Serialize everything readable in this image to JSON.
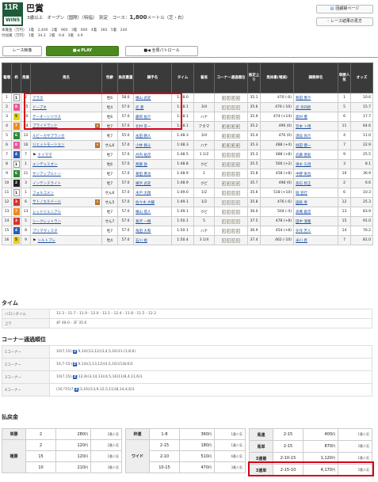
{
  "header": {
    "race_no": "11R",
    "badge": "WIN5",
    "title": "巴賞",
    "conditions_prefix": "3歳以上　オープン（国際）（特指）　別定　コース：",
    "distance": "1,800",
    "conditions_suffix": "メートル（芝・右）",
    "prize_line1": "本賞金（万円）　1着　2,400　2着　960　3着　600　4着　360　5着　240",
    "prize_line2": "付加賞（万円）　1着　34.3　2着　9.8　3着　4.9",
    "btn_tally": "回顧録ページ",
    "btn_result_list": "レース結果の見方"
  },
  "tabs": {
    "race_video": "レース映像",
    "play": "PLAY",
    "patrol": "全周パトロール"
  },
  "table": {
    "headers": [
      "着順",
      "枠",
      "馬番",
      "馬名",
      "性齢",
      "負担重量",
      "騎手名",
      "タイム",
      "着差",
      "コーナー通過順位",
      "推定上り",
      "馬体重(増減)",
      "調教師名",
      "単勝人気",
      "オッズ"
    ],
    "rows": [
      {
        "rank": "1",
        "waku": "1",
        "waku_class": "w1",
        "num": "2",
        "name": "アラタ",
        "sex": "牡6",
        "wt": "58.0",
        "jockey": "横山 武史",
        "time": "1:48.0",
        "margin": "",
        "corner": [
          "4",
          "3",
          "3",
          "4"
        ],
        "up": "35.1",
        "body": "470 (-6)",
        "trainer": "和田 勇介",
        "pop": "1",
        "odds": "10.6",
        "note": ""
      },
      {
        "rank": "2",
        "waku": "8",
        "waku_class": "w8",
        "num": "15",
        "name": "ドーブネ",
        "sex": "牡4",
        "wt": "57.0",
        "jockey": "武 豊",
        "time": "1:48.1",
        "margin": "3/4",
        "corner": [
          "1",
          "1",
          "1",
          "1"
        ],
        "up": "35.6",
        "body": "476 (-10)",
        "trainer": "武 幸四郎",
        "pop": "5",
        "odds": "15.7",
        "note": ""
      },
      {
        "rank": "3",
        "waku": "5",
        "waku_class": "w5",
        "num": "10",
        "name": "テーオーシリウス",
        "sex": "牡6",
        "wt": "57.0",
        "jockey": "藤岡 佑介",
        "time": "1:48.1",
        "margin": "ハナ",
        "corner": [
          "2",
          "2",
          "2",
          "2"
        ],
        "up": "35.9",
        "body": "474 (+14)",
        "trainer": "奥村 豊",
        "pop": "6",
        "odds": "17.7",
        "note": ""
      },
      {
        "rank": "4",
        "waku": "7",
        "waku_class": "w7",
        "num": "14",
        "name": "プライドランド",
        "sex": "牡7",
        "wt": "57.0",
        "jockey": "北村 友一",
        "time": "1:48.1",
        "margin": "アタマ",
        "corner": [
          "6",
          "6",
          "6",
          "6"
        ],
        "up": "35.2",
        "body": "496 (0)",
        "trainer": "宮本 ト博",
        "pop": "11",
        "odds": "64.6",
        "note": "B"
      },
      {
        "rank": "5",
        "waku": "6",
        "waku_class": "w6",
        "num": "12",
        "name": "ルビーカサブランカ",
        "sex": "牝7",
        "wt": "55.0",
        "jockey": "永田 朝人",
        "time": "1:48.3",
        "margin": "3/4",
        "corner": [
          "4",
          "4",
          "4",
          "4"
        ],
        "up": "35.4",
        "body": "476 (0)",
        "trainer": "須貝 尚介",
        "pop": "4",
        "odds": "11.0",
        "note": ""
      },
      {
        "rank": "6",
        "waku": "8",
        "waku_class": "w8",
        "num": "16",
        "name": "ジェットモーション",
        "sex": "せん6",
        "wt": "57.0",
        "jockey": "小林 脩斗",
        "time": "1:48.3",
        "margin": "ハナ",
        "corner": [
          "8",
          "8",
          "8",
          "8"
        ],
        "up": "35.3",
        "body": "488 (+4)",
        "trainer": "堀田 健一",
        "pop": "7",
        "odds": "22.9",
        "note": "B"
      },
      {
        "rank": "7",
        "waku": "4",
        "waku_class": "w4",
        "num": "7",
        "name": "ナイママ",
        "sex": "牡7",
        "wt": "57.0",
        "jockey": "丹内 祐次",
        "time": "1:48.5",
        "margin": "1 1/2",
        "corner": [
          "1",
          "1",
          "1",
          "1"
        ],
        "up": "35.3",
        "body": "488 (+8)",
        "trainer": "武藤 善則",
        "pop": "9",
        "odds": "25.5",
        "note": "flag"
      },
      {
        "rank": "8",
        "waku": "1",
        "waku_class": "w1",
        "num": "1",
        "name": "エンデュミオン",
        "sex": "牡6",
        "wt": "57.0",
        "jockey": "斎藤 敦",
        "time": "1:48.8",
        "margin": "クビ",
        "corner": [
          "4",
          "4",
          "4",
          "4"
        ],
        "up": "35.5",
        "body": "500 (+2)",
        "trainer": "清水 久詞",
        "pop": "3",
        "odds": "8.1",
        "note": ""
      },
      {
        "rank": "9",
        "waku": "6",
        "waku_class": "w6",
        "num": "11",
        "name": "サンアップルトン",
        "sex": "牡7",
        "wt": "57.0",
        "jockey": "菊田 勇治",
        "time": "1:48.9",
        "margin": "1",
        "corner": [
          "1",
          "1",
          "1",
          "1"
        ],
        "up": "35.8",
        "body": "458 (+8)",
        "trainer": "中野 栄治",
        "pop": "10",
        "odds": "36.9",
        "note": ""
      },
      {
        "rank": "10",
        "waku": "2",
        "waku_class": "w2",
        "num": "3",
        "name": "インテンスライト",
        "sex": "牡7",
        "wt": "57.0",
        "jockey": "横浜 武史",
        "time": "1:48.9",
        "margin": "クビ",
        "corner": [
          "4",
          "4",
          "4",
          "4"
        ],
        "up": "35.7",
        "body": "498 (0)",
        "trainer": "高石 昇正",
        "pop": "2",
        "odds": "6.6",
        "note": ""
      },
      {
        "rank": "11",
        "waku": "1",
        "waku_class": "w1",
        "num": "1",
        "name": "フォルコメン",
        "sex": "せん6",
        "wt": "57.0",
        "jockey": "木戸 大翔",
        "time": "1:49.0",
        "margin": "1/2",
        "corner": [
          "1",
          "1",
          "1",
          "1"
        ],
        "up": "35.6",
        "body": "518 (+10)",
        "trainer": "堀 宣行",
        "pop": "6",
        "odds": "10.3",
        "note": ""
      },
      {
        "rank": "12",
        "waku": "3",
        "waku_class": "w3",
        "num": "6",
        "name": "サトノエルドール",
        "sex": "せん5",
        "wt": "57.0",
        "jockey": "佐々木 大輔",
        "time": "1:49.1",
        "margin": "1/2",
        "corner": [
          "1",
          "1",
          "1",
          "1"
        ],
        "up": "35.8",
        "body": "476 (-6)",
        "trainer": "国枝 栄",
        "pop": "12",
        "odds": "25.3",
        "note": "B"
      },
      {
        "rank": "13",
        "waku": "7",
        "waku_class": "w7",
        "num": "13",
        "name": "レッドジェニアル",
        "sex": "牡7",
        "wt": "57.0",
        "jockey": "横山 琉人",
        "time": "1:49.1",
        "margin": "クビ",
        "corner": [
          "1",
          "1",
          "1",
          "1"
        ],
        "up": "36.0",
        "body": "504 (-4)",
        "trainer": "高橋 義忠",
        "pop": "13",
        "odds": "83.9",
        "note": ""
      },
      {
        "rank": "14",
        "waku": "3",
        "waku_class": "w3",
        "num": "5",
        "name": "シークレットラン",
        "sex": "せん7",
        "wt": "57.0",
        "jockey": "菊沢 一樹",
        "time": "1:50.1",
        "margin": "5",
        "corner": [
          "1",
          "1",
          "1",
          "1"
        ],
        "up": "37.5",
        "body": "478 (+8)",
        "trainer": "田中 清隆",
        "pop": "15",
        "odds": "91.0",
        "note": ""
      },
      {
        "rank": "15",
        "waku": "4",
        "waku_class": "w4",
        "num": "8",
        "name": "プリマヴィスタ",
        "sex": "牡7",
        "wt": "57.0",
        "jockey": "角田 大和",
        "time": "1:50.1",
        "margin": "ハナ",
        "corner": [
          "1",
          "1",
          "1",
          "1"
        ],
        "up": "36.9",
        "body": "454 (+8)",
        "trainer": "矢作 芳人",
        "pop": "14",
        "odds": "76.2",
        "note": ""
      },
      {
        "rank": "16",
        "waku": "5",
        "waku_class": "w5",
        "num": "9",
        "name": "シルトプレ",
        "sex": "牡4",
        "wt": "57.0",
        "jockey": "石川 裕",
        "time": "1:50.4",
        "margin": "3 1/4",
        "corner": [
          "1",
          "1",
          "1",
          "1"
        ],
        "up": "37.4",
        "body": "462 (-10)",
        "trainer": "米川 昇",
        "pop": "7",
        "odds": "81.0",
        "note": "flag"
      }
    ]
  },
  "time_section": {
    "title": "タイム",
    "rows": [
      {
        "label": "ハロンタイム",
        "value": "12.3 - 11.7 - 11.9 - 12.0 - 12.1 - 12.4 - 11.8 - 11.5 - 12.2"
      },
      {
        "label": "上り",
        "value": "4F 48.0 - 3F 35.6"
      }
    ]
  },
  "corner_section": {
    "title": "コーナー通過順位",
    "rows": [
      {
        "label": "1コーナー",
        "value": "10(7,15)-",
        "mark": "2",
        "rest": ",9,14)(13,12)(3,4,5,16)11-(1,8,6)"
      },
      {
        "label": "2コーナー",
        "value": "10,7-15-(",
        "mark": "2",
        "rest": ",9,14)(3,13,12)(4,5,16)11(8,6)1"
      },
      {
        "label": "3コーナー",
        "value": "10(7,15)-",
        "mark": "2",
        "rest": "(12,9)(3,14,13)(4,5,16)11(8,4,11,6)1"
      },
      {
        "label": "4コーナー",
        "value": "(10,*15)7,",
        "mark": "2",
        "rest": "(3,16)(13,9,12,5,11)(8,14,4,6)1"
      }
    ]
  },
  "payout_section": {
    "title": "払戻金",
    "col1": [
      {
        "type": "単勝",
        "rows": [
          {
            "comb": "2",
            "amount": "280",
            "unit": "円",
            "pop": "2番人気"
          }
        ]
      },
      {
        "type": "複勝",
        "rows": [
          {
            "comb": "2",
            "amount": "120",
            "unit": "円",
            "pop": "2番人気"
          },
          {
            "comb": "15",
            "amount": "120",
            "unit": "円",
            "pop": "1番人気"
          },
          {
            "comb": "10",
            "amount": "210",
            "unit": "円",
            "pop": "3番人気"
          }
        ]
      }
    ],
    "col2": [
      {
        "type": "枠連",
        "rows": [
          {
            "comb": "1-8",
            "amount": "360",
            "unit": "円",
            "pop": "1番人気"
          }
        ]
      },
      {
        "type": "ワイド",
        "rows": [
          {
            "comb": "2-15",
            "amount": "180",
            "unit": "円",
            "pop": "1番人気"
          },
          {
            "comb": "2-10",
            "amount": "510",
            "unit": "円",
            "pop": "6番人気"
          },
          {
            "comb": "10-15",
            "amount": "470",
            "unit": "円",
            "pop": "3番人気"
          }
        ]
      }
    ],
    "col3": [
      {
        "type": "馬連",
        "rows": [
          {
            "comb": "2-15",
            "amount": "400",
            "unit": "円",
            "pop": "1番人気"
          }
        ]
      },
      {
        "type": "馬単",
        "rows": [
          {
            "comb": "2-15",
            "amount": "870",
            "unit": "円",
            "pop": "2番人気"
          }
        ]
      },
      {
        "type": "3連複",
        "rows": [
          {
            "comb": "2-10-15",
            "amount": "1,120",
            "unit": "円",
            "pop": "1番人気"
          }
        ]
      },
      {
        "type": "3連単",
        "rows": [
          {
            "comb": "2-15-10",
            "amount": "4,170",
            "unit": "円",
            "pop": "5番人気"
          }
        ]
      }
    ]
  },
  "colors": {
    "header_bg": "#3a3a3a",
    "accent_green": "#1d5b3a",
    "play_green": "#4a8a1f",
    "highlight_red": "#d60012"
  }
}
